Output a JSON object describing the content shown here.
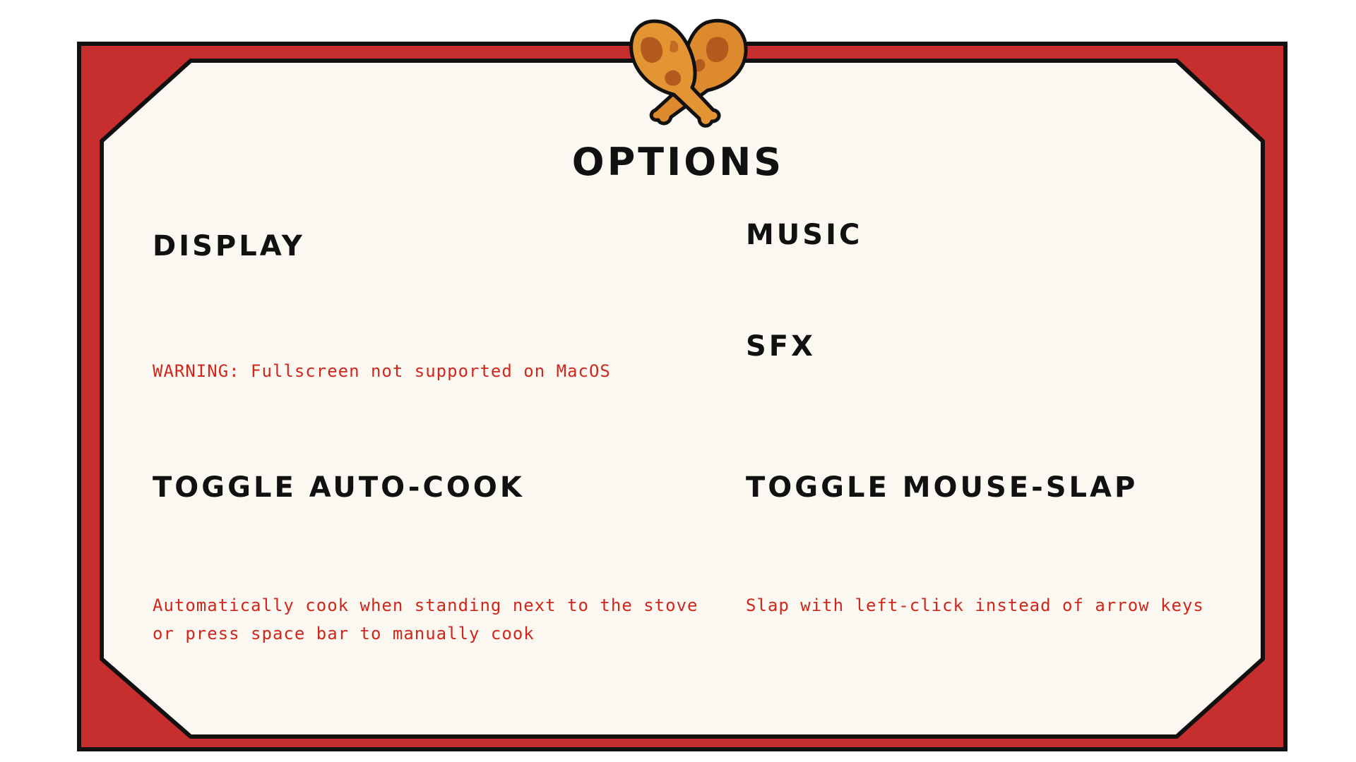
{
  "menu": {
    "title": "OPTIONS",
    "sections": {
      "display": {
        "heading": "DISPLAY",
        "warning": "WARNING: Fullscreen not supported on MacOS"
      },
      "music": {
        "heading": "MUSIC"
      },
      "sfx": {
        "heading": "SFX"
      },
      "auto_cook": {
        "heading": "TOGGLE AUTO-COOK",
        "description": [
          "Automatically cook when standing next to the stove",
          "or press space bar to manually cook"
        ]
      },
      "mouse_slap": {
        "heading": "TOGGLE MOUSE-SLAP",
        "description": "Slap with left-click instead of arrow keys"
      }
    }
  },
  "theme": {
    "frame_red": "#c62f2e",
    "panel_cream": "#faf8f1",
    "outline": "#111111",
    "heading_color": "#111111",
    "note_red": "#d0271d",
    "drumstick_orange": "#dd8a2e",
    "drumstick_brown": "#b45a1e"
  },
  "icons": {
    "emblem": "crossed-chicken-drumsticks-icon"
  }
}
